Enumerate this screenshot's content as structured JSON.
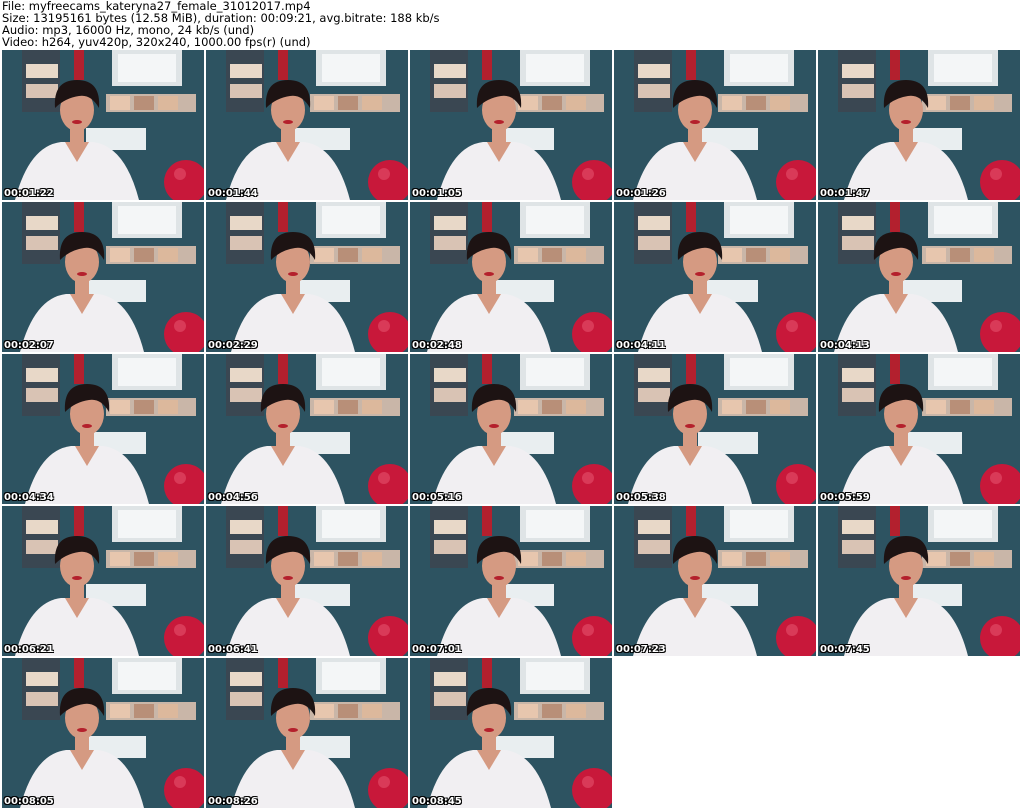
{
  "header": {
    "file_line": "File: myfreecams_kateryna27_female_31012017.mp4",
    "size_line": "Size: 13195161 bytes (12.58 MiB), duration: 00:09:21, avg.bitrate: 188 kb/s",
    "audio_line": "Audio: mp3, 16000 Hz, mono, 24 kb/s (und)",
    "video_line": "Video: h264, yuv420p, 320x240, 1000.00 fps(r) (und)"
  },
  "thumbnails": [
    "00:01:22",
    "00:01:44",
    "00:01:05",
    "00:01:26",
    "00:01:47",
    "00:02:07",
    "00:02:29",
    "00:02:48",
    "00:04:11",
    "00:04:13",
    "00:04:34",
    "00:04:56",
    "00:05:16",
    "00:05:38",
    "00:05:59",
    "00:06:21",
    "00:06:41",
    "00:07:01",
    "00:07:23",
    "00:07:45",
    "00:08:05",
    "00:08:26",
    "00:08:45"
  ],
  "colors": {
    "wall": "#2d5361",
    "shirt": "#f1eff2",
    "ball": "#c8183a",
    "hair": "#1d1313",
    "skin": "#d59a82"
  }
}
